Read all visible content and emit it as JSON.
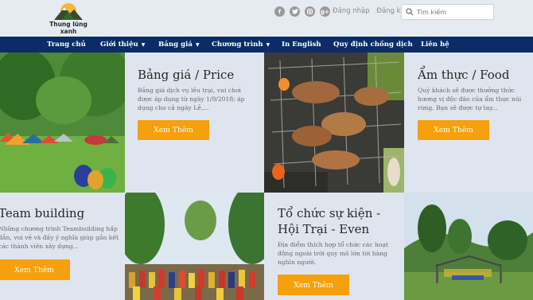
{
  "logo": {
    "name": "Thung lũng xanh"
  },
  "social": [
    "f",
    "t",
    "ig",
    "g+"
  ],
  "auth": {
    "login": "Đăng nhập",
    "register": "Đăng ký"
  },
  "search": {
    "placeholder": "Tìm kiếm"
  },
  "nav": [
    {
      "label": "Trang chủ"
    },
    {
      "label": "Giới thiệu"
    },
    {
      "label": "Bảng giá"
    },
    {
      "label": "Chương trình"
    },
    {
      "label": "In English"
    },
    {
      "label": "Quy định chống dịch"
    },
    {
      "label": "Liên hệ"
    }
  ],
  "cards": [
    {
      "title": "Bảng giá / Price",
      "desc": "Bảng giá dịch vụ lều trại, vui chơi được áp dụng từ ngày 1/9/2018; áp dụng cho cả ngày Lễ,...",
      "button": "Xem  Thêm"
    },
    {
      "title": "Ẩm thực / Food",
      "desc": "Quý khách sẽ được thưởng thức hương vị độc đáo của ẩm thực núi rừng. Bạn sẽ được tự tay...",
      "button": "Xem  Thêm"
    },
    {
      "title": "Team building",
      "desc": "Những chương trình Teambuilding hấp dẫn, vui vẻ và đầy ý nghĩa giúp gắn kết các thành viên xây dựng...",
      "button": "Xem  Thêm"
    },
    {
      "title": "Tổ chức sự kiện - Hội Trại - Even",
      "desc": "Địa điểm thích hợp tổ chức các hoạt động ngoài trời quy mô lớn tới hàng nghìn người.",
      "button": "Xem  Thêm"
    }
  ],
  "colors": {
    "nav_bg": "#0b2c66",
    "button_bg": "#f5a00c",
    "tile_bg": "#dfe5ee"
  }
}
